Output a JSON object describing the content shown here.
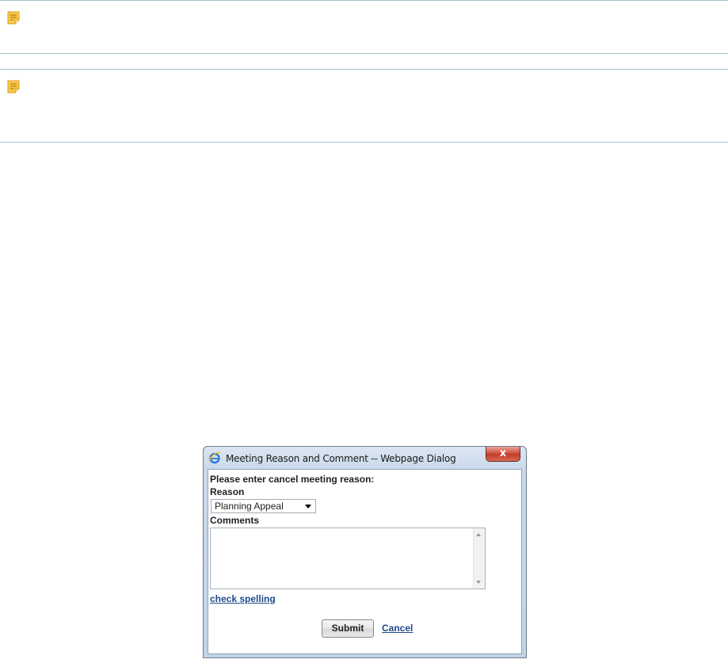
{
  "colors": {
    "note_rule": "#9fc3cc",
    "note_icon": "#f2b43a",
    "link": "#1f4a8a",
    "close_button": "#c94a36"
  },
  "notes": [
    {
      "icon": "note-icon"
    },
    {
      "icon": "note-icon"
    }
  ],
  "dialog": {
    "icon": "internet-explorer-icon",
    "title": "Meeting Reason and Comment -- Webpage Dialog",
    "close_glyph": "x",
    "prompt": "Please enter cancel meeting reason:",
    "reason_label": "Reason",
    "reason_value": "Planning Appeal",
    "comments_label": "Comments",
    "comments_value": "",
    "check_spelling": "check spelling",
    "submit": "Submit",
    "cancel": "Cancel"
  }
}
